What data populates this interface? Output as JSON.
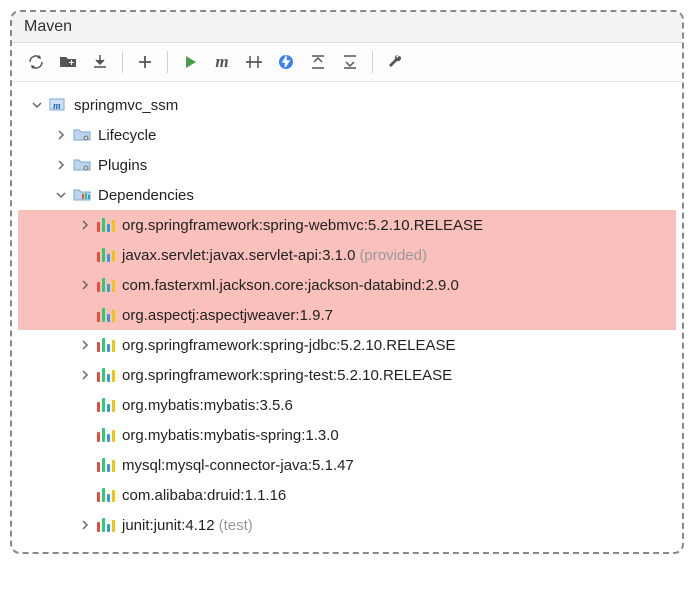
{
  "panel": {
    "title": "Maven"
  },
  "toolbar": {
    "reload": "Reimport",
    "generate": "Generate",
    "download": "Download",
    "add": "Add",
    "run": "Run",
    "maven": "m",
    "skip": "Toggle Skip Tests",
    "offline": "Offline",
    "collapse": "Collapse",
    "expand": "Expand",
    "settings": "Settings"
  },
  "tree": {
    "root": {
      "label": "springmvc_ssm"
    },
    "lifecycle": {
      "label": "Lifecycle"
    },
    "plugins": {
      "label": "Plugins"
    },
    "dependencies": {
      "label": "Dependencies"
    },
    "deps": [
      {
        "label": "org.springframework:spring-webmvc:5.2.10.RELEASE",
        "scope": "",
        "expandable": true,
        "highlight": true
      },
      {
        "label": "javax.servlet:javax.servlet-api:3.1.0",
        "scope": "(provided)",
        "expandable": false,
        "highlight": true
      },
      {
        "label": "com.fasterxml.jackson.core:jackson-databind:2.9.0",
        "scope": "",
        "expandable": true,
        "highlight": true
      },
      {
        "label": "org.aspectj:aspectjweaver:1.9.7",
        "scope": "",
        "expandable": false,
        "highlight": true
      },
      {
        "label": "org.springframework:spring-jdbc:5.2.10.RELEASE",
        "scope": "",
        "expandable": true,
        "highlight": false
      },
      {
        "label": "org.springframework:spring-test:5.2.10.RELEASE",
        "scope": "",
        "expandable": true,
        "highlight": false
      },
      {
        "label": "org.mybatis:mybatis:3.5.6",
        "scope": "",
        "expandable": false,
        "highlight": false
      },
      {
        "label": "org.mybatis:mybatis-spring:1.3.0",
        "scope": "",
        "expandable": false,
        "highlight": false
      },
      {
        "label": "mysql:mysql-connector-java:5.1.47",
        "scope": "",
        "expandable": false,
        "highlight": false
      },
      {
        "label": "com.alibaba:druid:1.1.16",
        "scope": "",
        "expandable": false,
        "highlight": false
      },
      {
        "label": "junit:junit:4.12",
        "scope": "(test)",
        "expandable": true,
        "highlight": false
      }
    ]
  }
}
